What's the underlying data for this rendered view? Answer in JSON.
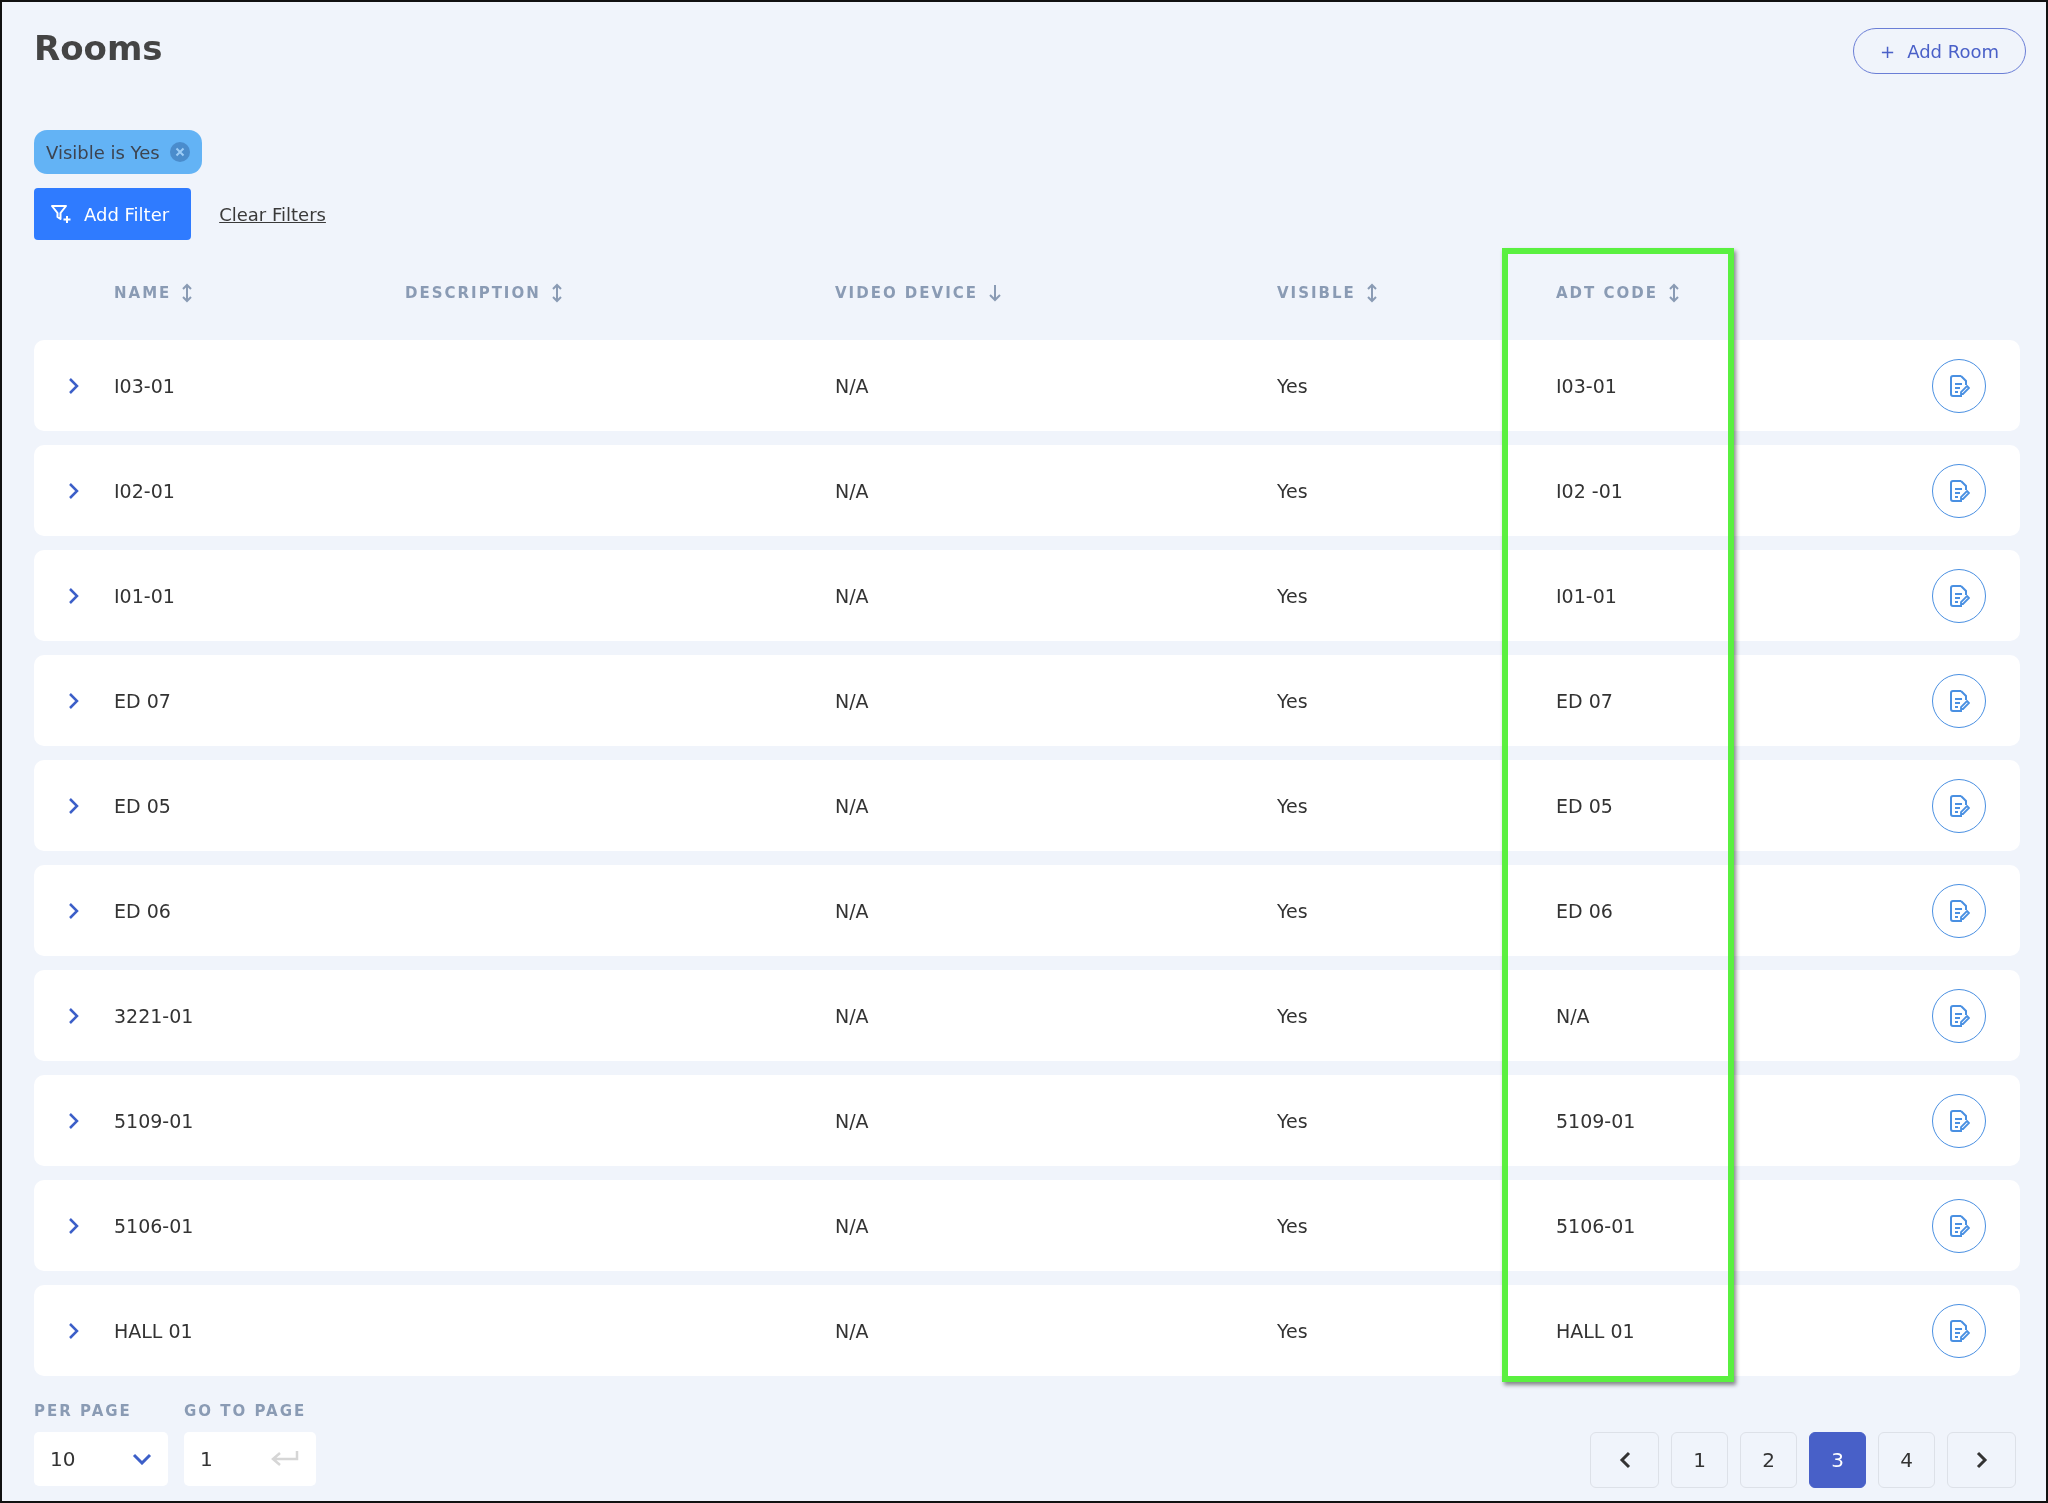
{
  "title": "Rooms",
  "add_room_button": {
    "icon": "+",
    "label": "Add Room"
  },
  "filter_chips": [
    {
      "label": "Visible is Yes"
    }
  ],
  "add_filter_button": "Add Filter",
  "clear_filters_link": "Clear Filters",
  "columns": [
    {
      "label": "NAME",
      "kind": "sortable",
      "highlighted": false
    },
    {
      "label": "DESCRIPTION",
      "kind": "sortable",
      "highlighted": false
    },
    {
      "label": "VIDEO DEVICE",
      "kind": "sorted",
      "highlighted": false
    },
    {
      "label": "VISIBLE",
      "kind": "sortable",
      "highlighted": false
    },
    {
      "label": "ADT CODE",
      "kind": "sortable",
      "highlighted": true
    }
  ],
  "rows": [
    {
      "name": "I03-01",
      "video_device": "N/A",
      "visible": "Yes",
      "adt_code": "I03-01"
    },
    {
      "name": "I02-01",
      "video_device": "N/A",
      "visible": "Yes",
      "adt_code": "I02 -01"
    },
    {
      "name": "I01-01",
      "video_device": "N/A",
      "visible": "Yes",
      "adt_code": "I01-01"
    },
    {
      "name": "ED 07",
      "video_device": "N/A",
      "visible": "Yes",
      "adt_code": "ED 07"
    },
    {
      "name": "ED 05",
      "video_device": "N/A",
      "visible": "Yes",
      "adt_code": "ED 05"
    },
    {
      "name": "ED 06",
      "video_device": "N/A",
      "visible": "Yes",
      "adt_code": "ED 06"
    },
    {
      "name": "3221-01",
      "video_device": "N/A",
      "visible": "Yes",
      "adt_code": "N/A"
    },
    {
      "name": "5109-01",
      "video_device": "N/A",
      "visible": "Yes",
      "adt_code": "5109-01"
    },
    {
      "name": "5106-01",
      "video_device": "N/A",
      "visible": "Yes",
      "adt_code": "5106-01"
    },
    {
      "name": "HALL 01",
      "video_device": "N/A",
      "visible": "Yes",
      "adt_code": "HALL 01"
    }
  ],
  "per_page": {
    "label": "PER PAGE",
    "value": "10"
  },
  "go_to_page": {
    "label": "GO TO PAGE",
    "value": "1"
  },
  "pagination": {
    "pages": [
      {
        "label": "1",
        "selected": false
      },
      {
        "label": "2",
        "selected": false
      },
      {
        "label": "3",
        "selected": true
      },
      {
        "label": "4",
        "selected": false
      }
    ]
  }
}
